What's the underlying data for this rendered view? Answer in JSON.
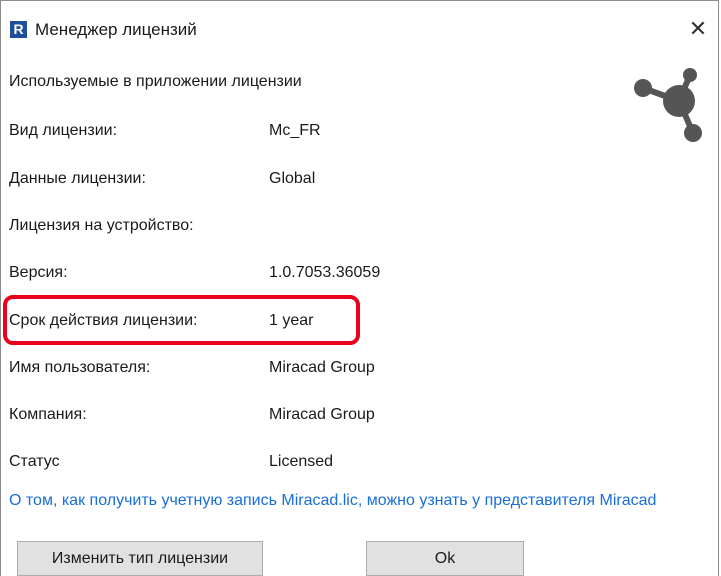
{
  "window": {
    "title": "Менеджер лицензий",
    "app_icon_letter": "R",
    "close_glyph": "✕"
  },
  "section_title": "Используемые в приложении лицензии",
  "rows": [
    {
      "label": "Вид лицензии:",
      "value": "Mc_FR"
    },
    {
      "label": "Данные лицензии:",
      "value": "Global"
    },
    {
      "label": "Лицензия на устройство:",
      "value": ""
    },
    {
      "label": "Версия:",
      "value": "1.0.7053.36059"
    },
    {
      "label": "Срок действия лицензии:",
      "value": "1 year"
    },
    {
      "label": "Имя пользователя:",
      "value": "Miracad Group"
    },
    {
      "label": "Компания:",
      "value": "Miracad Group"
    },
    {
      "label": "Статус",
      "value": "Licensed"
    }
  ],
  "info_link": "О том, как получить учетную запись Miracad.lic, можно узнать у представителя Miracad",
  "buttons": {
    "change_license": "Изменить тип лицензии",
    "ok": "Ok"
  },
  "colors": {
    "accent": "#1a6ed8",
    "highlight": "#e8001c",
    "logo": "#555555",
    "app_icon": "#1f4e9b"
  },
  "icons": {
    "logo": "molecule-logo-icon",
    "app": "revit-r-icon",
    "close": "close-icon"
  }
}
